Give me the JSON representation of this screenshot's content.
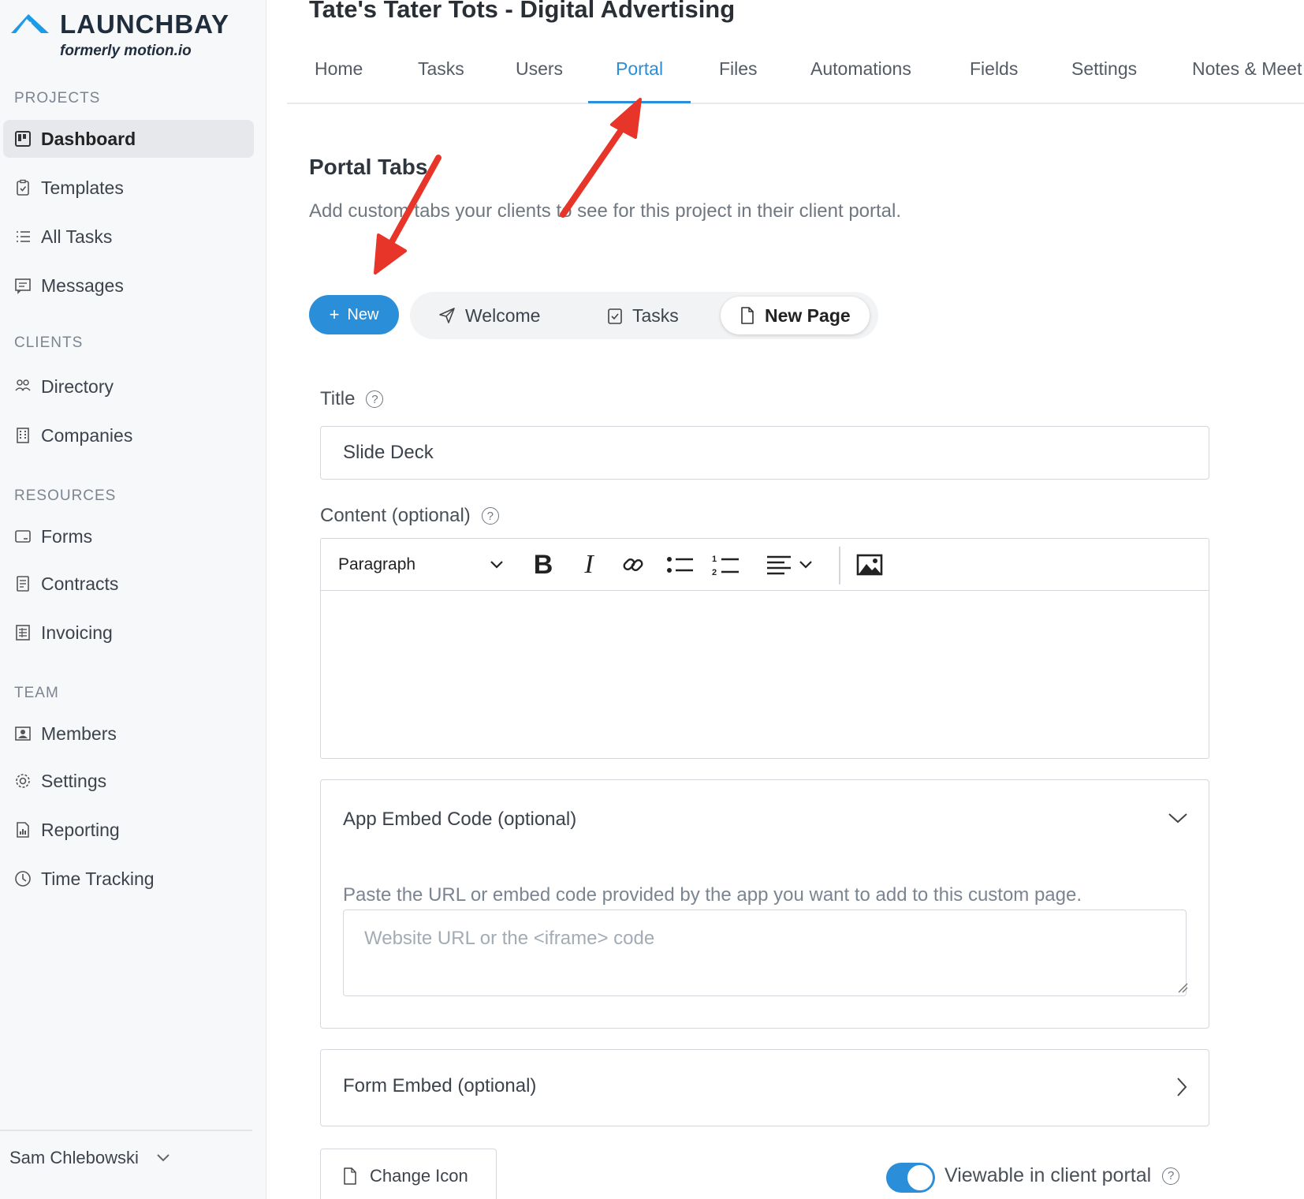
{
  "brand": {
    "name": "LAUNCHBAY",
    "subtitle": "formerly motion.io",
    "color": "#1e9be6"
  },
  "sidebar": {
    "sections": {
      "projects": "PROJECTS",
      "clients": "CLIENTS",
      "resources": "RESOURCES",
      "team": "TEAM"
    },
    "items": [
      {
        "label": "Dashboard",
        "icon": "dashboard-icon",
        "active": true
      },
      {
        "label": "Templates",
        "icon": "clipboard-icon"
      },
      {
        "label": "All Tasks",
        "icon": "list-icon"
      },
      {
        "label": "Messages",
        "icon": "message-icon"
      },
      {
        "label": "Directory",
        "icon": "people-icon"
      },
      {
        "label": "Companies",
        "icon": "building-icon"
      },
      {
        "label": "Forms",
        "icon": "form-icon"
      },
      {
        "label": "Contracts",
        "icon": "document-icon"
      },
      {
        "label": "Invoicing",
        "icon": "invoice-icon"
      },
      {
        "label": "Members",
        "icon": "member-icon"
      },
      {
        "label": "Settings",
        "icon": "gear-icon"
      },
      {
        "label": "Reporting",
        "icon": "report-icon"
      },
      {
        "label": "Time Tracking",
        "icon": "clock-icon"
      }
    ],
    "user": "Sam Chlebowski"
  },
  "header": {
    "title": "Tate's Tater Tots - Digital Advertising",
    "tabs": [
      {
        "label": "Home"
      },
      {
        "label": "Tasks"
      },
      {
        "label": "Users"
      },
      {
        "label": "Portal",
        "active": true
      },
      {
        "label": "Files"
      },
      {
        "label": "Automations"
      },
      {
        "label": "Fields"
      },
      {
        "label": "Settings"
      },
      {
        "label": "Notes & Meet"
      }
    ],
    "accent": "#2a8ed8"
  },
  "portal": {
    "heading": "Portal Tabs",
    "description": "Add custom tabs your clients to see for this project in their client portal.",
    "new_button": "New",
    "tabs": [
      {
        "label": "Welcome",
        "icon": "send-icon"
      },
      {
        "label": "Tasks",
        "icon": "clipboard-check-icon"
      },
      {
        "label": "New Page",
        "icon": "page-icon",
        "selected": true
      }
    ]
  },
  "form": {
    "title_label": "Title",
    "title_value": "Slide Deck",
    "content_label": "Content (optional)",
    "paragraph_select": "Paragraph",
    "embed": {
      "title": "App Embed Code (optional)",
      "help": "Paste the URL or embed code provided by the app you want to add to this custom page.",
      "placeholder": "Website URL or the <iframe> code"
    },
    "form_embed_title": "Form Embed (optional)",
    "change_icon": "Change Icon",
    "viewable_label": "Viewable in client portal",
    "viewable": true
  },
  "annotation_color": "#e8352a"
}
